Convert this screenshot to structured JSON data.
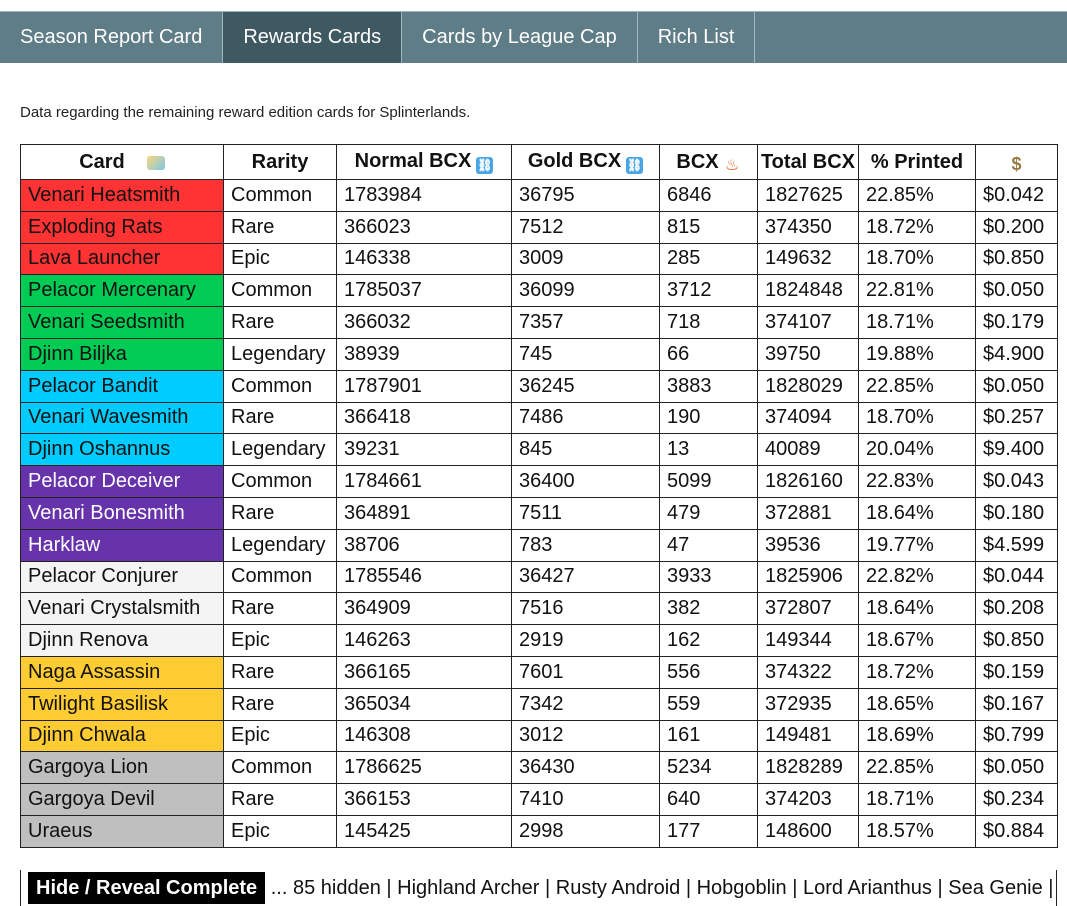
{
  "tabs": [
    {
      "label": "Season Report Card"
    },
    {
      "label": "Rewards Cards"
    },
    {
      "label": "Cards by League Cap"
    },
    {
      "label": "Rich List"
    }
  ],
  "description": "Data regarding the remaining reward edition cards for Splinterlands.",
  "table": {
    "headers": {
      "card": "Card",
      "rarity": "Rarity",
      "normal": "Normal BCX",
      "gold": "Gold BCX",
      "bcx": "BCX",
      "total": "Total BCX",
      "printed": "% Printed"
    },
    "icons": {
      "card": "rainbow-card-icon",
      "normal": "link-icon",
      "gold": "link-icon",
      "bcx": "fire-icon",
      "price": "money-bag-icon"
    },
    "colors": {
      "red": "#ff3333",
      "green": "#00cc55",
      "blue": "#00ccff",
      "purple": "#6633aa",
      "white": "#f4f4f4",
      "gold": "#ffcc33",
      "gray": "#bfbfbf"
    },
    "rows": [
      {
        "color": "red",
        "name": "Venari Heatsmith",
        "rarity": "Common",
        "normal": "1783984",
        "gold": "36795",
        "bcx": "6846",
        "total": "1827625",
        "printed": "22.85%",
        "price": "$0.042"
      },
      {
        "color": "red",
        "name": "Exploding Rats",
        "rarity": "Rare",
        "normal": "366023",
        "gold": "7512",
        "bcx": "815",
        "total": "374350",
        "printed": "18.72%",
        "price": "$0.200"
      },
      {
        "color": "red",
        "name": "Lava Launcher",
        "rarity": "Epic",
        "normal": "146338",
        "gold": "3009",
        "bcx": "285",
        "total": "149632",
        "printed": "18.70%",
        "price": "$0.850"
      },
      {
        "color": "green",
        "name": "Pelacor Mercenary",
        "rarity": "Common",
        "normal": "1785037",
        "gold": "36099",
        "bcx": "3712",
        "total": "1824848",
        "printed": "22.81%",
        "price": "$0.050"
      },
      {
        "color": "green",
        "name": "Venari Seedsmith",
        "rarity": "Rare",
        "normal": "366032",
        "gold": "7357",
        "bcx": "718",
        "total": "374107",
        "printed": "18.71%",
        "price": "$0.179"
      },
      {
        "color": "green",
        "name": "Djinn Biljka",
        "rarity": "Legendary",
        "normal": "38939",
        "gold": "745",
        "bcx": "66",
        "total": "39750",
        "printed": "19.88%",
        "price": "$4.900"
      },
      {
        "color": "blue",
        "name": "Pelacor Bandit",
        "rarity": "Common",
        "normal": "1787901",
        "gold": "36245",
        "bcx": "3883",
        "total": "1828029",
        "printed": "22.85%",
        "price": "$0.050"
      },
      {
        "color": "blue",
        "name": "Venari Wavesmith",
        "rarity": "Rare",
        "normal": "366418",
        "gold": "7486",
        "bcx": "190",
        "total": "374094",
        "printed": "18.70%",
        "price": "$0.257"
      },
      {
        "color": "blue",
        "name": "Djinn Oshannus",
        "rarity": "Legendary",
        "normal": "39231",
        "gold": "845",
        "bcx": "13",
        "total": "40089",
        "printed": "20.04%",
        "price": "$9.400"
      },
      {
        "color": "purple",
        "name": "Pelacor Deceiver",
        "rarity": "Common",
        "normal": "1784661",
        "gold": "36400",
        "bcx": "5099",
        "total": "1826160",
        "printed": "22.83%",
        "price": "$0.043"
      },
      {
        "color": "purple",
        "name": "Venari Bonesmith",
        "rarity": "Rare",
        "normal": "364891",
        "gold": "7511",
        "bcx": "479",
        "total": "372881",
        "printed": "18.64%",
        "price": "$0.180"
      },
      {
        "color": "purple",
        "name": "Harklaw",
        "rarity": "Legendary",
        "normal": "38706",
        "gold": "783",
        "bcx": "47",
        "total": "39536",
        "printed": "19.77%",
        "price": "$4.599"
      },
      {
        "color": "white",
        "name": "Pelacor Conjurer",
        "rarity": "Common",
        "normal": "1785546",
        "gold": "36427",
        "bcx": "3933",
        "total": "1825906",
        "printed": "22.82%",
        "price": "$0.044"
      },
      {
        "color": "white",
        "name": "Venari Crystalsmith",
        "rarity": "Rare",
        "normal": "364909",
        "gold": "7516",
        "bcx": "382",
        "total": "372807",
        "printed": "18.64%",
        "price": "$0.208"
      },
      {
        "color": "white",
        "name": "Djinn Renova",
        "rarity": "Epic",
        "normal": "146263",
        "gold": "2919",
        "bcx": "162",
        "total": "149344",
        "printed": "18.67%",
        "price": "$0.850"
      },
      {
        "color": "gold",
        "name": "Naga Assassin",
        "rarity": "Rare",
        "normal": "366165",
        "gold": "7601",
        "bcx": "556",
        "total": "374322",
        "printed": "18.72%",
        "price": "$0.159"
      },
      {
        "color": "gold",
        "name": "Twilight Basilisk",
        "rarity": "Rare",
        "normal": "365034",
        "gold": "7342",
        "bcx": "559",
        "total": "372935",
        "printed": "18.65%",
        "price": "$0.167"
      },
      {
        "color": "gold",
        "name": "Djinn Chwala",
        "rarity": "Epic",
        "normal": "146308",
        "gold": "3012",
        "bcx": "161",
        "total": "149481",
        "printed": "18.69%",
        "price": "$0.799"
      },
      {
        "color": "gray",
        "name": "Gargoya Lion",
        "rarity": "Common",
        "normal": "1786625",
        "gold": "36430",
        "bcx": "5234",
        "total": "1828289",
        "printed": "22.85%",
        "price": "$0.050"
      },
      {
        "color": "gray",
        "name": "Gargoya Devil",
        "rarity": "Rare",
        "normal": "366153",
        "gold": "7410",
        "bcx": "640",
        "total": "374203",
        "printed": "18.71%",
        "price": "$0.234"
      },
      {
        "color": "gray",
        "name": "Uraeus",
        "rarity": "Epic",
        "normal": "145425",
        "gold": "2998",
        "bcx": "177",
        "total": "148600",
        "printed": "18.57%",
        "price": "$0.884"
      }
    ]
  },
  "footer": {
    "toggle_label": "Hide / Reveal Complete",
    "hidden_text": "... 85 hidden | Highland Archer | Rusty Android | Hobgoblin | Lord Arianthus | Sea Genie |"
  }
}
